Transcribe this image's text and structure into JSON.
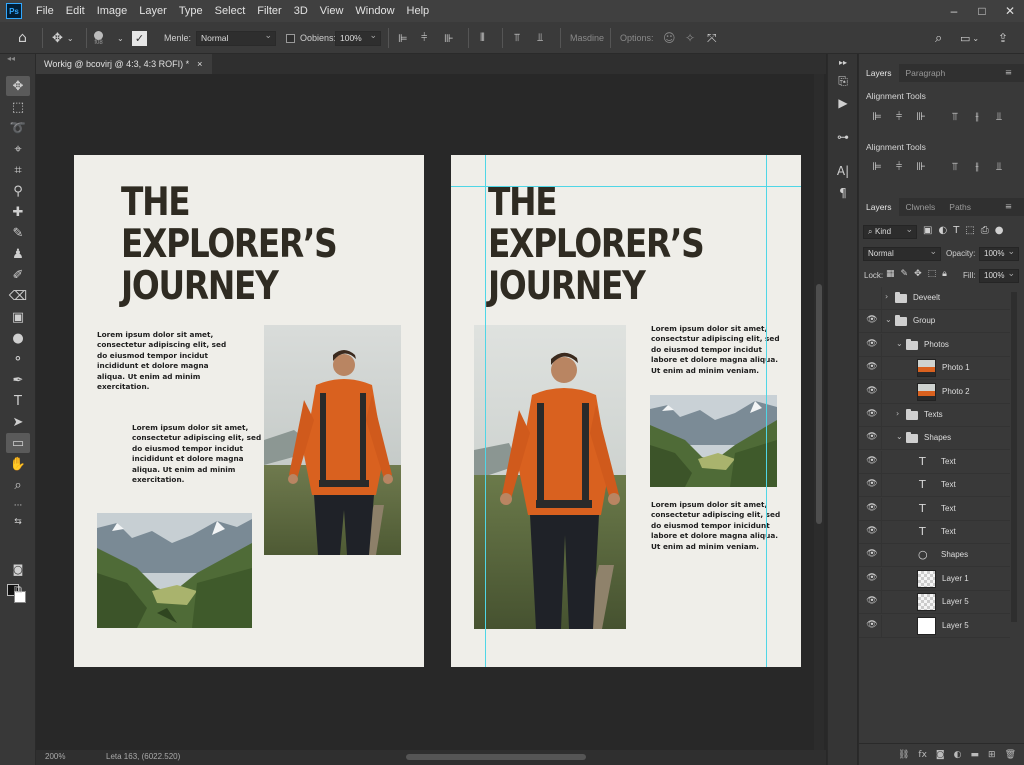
{
  "app": {
    "logo": "Ps",
    "menus": [
      "File",
      "Edit",
      "Image",
      "Layer",
      "Type",
      "Select",
      "Filter",
      "3D",
      "View",
      "Window",
      "Help"
    ],
    "window_controls": [
      "–",
      "□",
      "✕"
    ]
  },
  "options_bar": {
    "brush_size": "f08",
    "mode_label": "Menle:",
    "mode_value": "Normal",
    "opacity_label": "Oobiens:",
    "opacity_value": "100%",
    "masdine_label": "Masdine",
    "options_label": "Options:"
  },
  "document": {
    "tab_title": "Workig @ bcovirj @ 4:3, 4:3 ROFI) *",
    "tab_close": "×",
    "zoom": "200%",
    "status_info": "Leta 163, (6022.520)"
  },
  "pages": {
    "left": {
      "title_lines": [
        "THE",
        "EXPLORER’S",
        "JOURNEY"
      ],
      "para1": "Lorem ipsum dolor sit amet, consectetur adipiscing elit, sed do eiusmod tempor incidut incididunt et dolore magna aliqua. Ut enim ad minim exercitation.",
      "para2": "Lorem ipsum dolor sit amet, consectetur adipiscing elit, sed do eiusmod tempor incidut incididunt et dolore magna aliqua. Ut enim ad minim exercitation."
    },
    "right": {
      "title_lines": [
        "THE",
        "EXPLORER’S",
        "JOURNEY"
      ],
      "para1": "Lorem ipsum dolor sit amet, consectstur adipiscing elit, sed do eiusmod tempor incidut labore et dolore magna aliqua. Ut enim ad minim veniam.",
      "para2": "Lorem ipsum dolor sit amet, consectetur adipiscing elit, sed do eiusmod tempor inicidunt labore et dolore magna aliqua. Ut enim ad minim veniam."
    }
  },
  "panels": {
    "top_tabs": [
      "Layers",
      "Paragraph"
    ],
    "align_section_1": "Alignment Tools",
    "align_section_2": "Alignment Tools",
    "layers_tabs": [
      "Layers",
      "Clwnels",
      "Paths"
    ],
    "kind_label": "Kind",
    "blend_mode": "Normal",
    "opacity_label": "Opacity:",
    "opacity_value": "100%",
    "lock_label": "Lock:",
    "fill_label": "Fill:",
    "fill_value": "100%",
    "layers": [
      {
        "name": "Deveelt",
        "type": "folder",
        "eye": false,
        "indent": 0,
        "caret": "›"
      },
      {
        "name": "Group",
        "type": "folder",
        "eye": true,
        "indent": 0,
        "caret": "⌄"
      },
      {
        "name": "Photos",
        "type": "folder",
        "eye": true,
        "indent": 1,
        "caret": "⌄"
      },
      {
        "name": "Photo 1",
        "type": "photo",
        "eye": true,
        "indent": 2
      },
      {
        "name": "Photo 2",
        "type": "photo",
        "eye": true,
        "indent": 2
      },
      {
        "name": "Texts",
        "type": "folder",
        "eye": true,
        "indent": 1,
        "caret": "›"
      },
      {
        "name": "Shapes",
        "type": "folder",
        "eye": true,
        "indent": 1,
        "caret": "⌄"
      },
      {
        "name": "Text",
        "type": "text",
        "eye": true,
        "indent": 2
      },
      {
        "name": "Text",
        "type": "text",
        "eye": true,
        "indent": 2
      },
      {
        "name": "Text",
        "type": "text",
        "eye": true,
        "indent": 2
      },
      {
        "name": "Text",
        "type": "text",
        "eye": true,
        "indent": 2
      },
      {
        "name": "Shapes",
        "type": "shape",
        "eye": true,
        "indent": 2
      },
      {
        "name": "Layer 1",
        "type": "pixel",
        "eye": true,
        "indent": 2
      },
      {
        "name": "Layer 5",
        "type": "pixel",
        "eye": true,
        "indent": 2
      },
      {
        "name": "Layer 5",
        "type": "white",
        "eye": true,
        "indent": 2
      }
    ]
  },
  "colors": {
    "page_bg": "#efeee9",
    "title_text": "#2f2b22",
    "guide": "#4fd6e6",
    "jacket": "#d9611f"
  }
}
